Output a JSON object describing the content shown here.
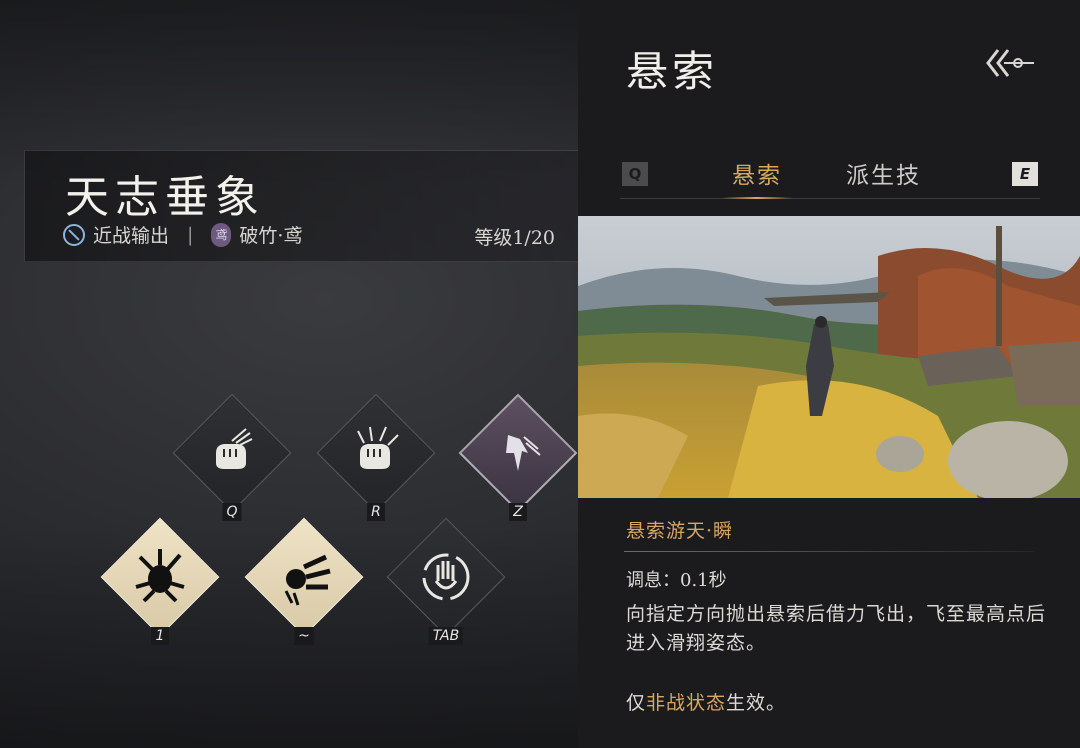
{
  "weapon_banner": {
    "title": "天志垂象",
    "role": "近战输出",
    "separator": "|",
    "weapon_icon_text": "鸢",
    "weapon": "破竹·鸢",
    "level": "等级1/20"
  },
  "skills": [
    {
      "key": "Q",
      "icon": "fist-claw-icon",
      "style": "dark"
    },
    {
      "key": "R",
      "icon": "fist-spikes-icon",
      "style": "dark"
    },
    {
      "key": "Z",
      "icon": "bird-dive-icon",
      "style": "purple"
    },
    {
      "key": "1",
      "icon": "shadow-burst-icon",
      "style": "light"
    },
    {
      "key": "~",
      "icon": "fist-strikes-icon",
      "style": "light"
    },
    {
      "key": "TAB",
      "icon": "hand-circle-icon",
      "style": "dark"
    }
  ],
  "panel": {
    "title": "悬索",
    "tabs": {
      "prev_key": "Q",
      "next_key": "E",
      "active": "悬索",
      "inactive": "派生技"
    },
    "skill_name": "悬索游天·瞬",
    "cooldown": "调息：0.1秒",
    "description": "向指定方向抛出悬索后借力飞出，飞至最高点后进入滑翔姿态。",
    "note_prefix": "仅",
    "note_highlight": "非战状态",
    "note_suffix": "生效。"
  },
  "colors": {
    "accent": "#d9a760",
    "panel_bg": "#1b1b1d"
  }
}
